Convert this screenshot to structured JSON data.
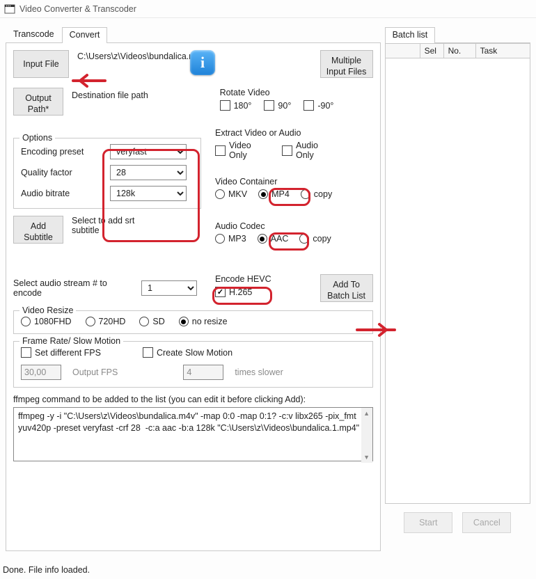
{
  "window": {
    "title": "Video Converter & Transcoder"
  },
  "tabs": {
    "left": [
      {
        "label": "Transcode",
        "active": false
      },
      {
        "label": "Convert",
        "active": true
      }
    ],
    "right": [
      {
        "label": "Batch list",
        "active": true
      }
    ]
  },
  "inputFile": {
    "button": "Input File",
    "path": "C:\\Users\\z\\Videos\\bundalica.m4v"
  },
  "multiInput": {
    "button": "Multiple Input Files"
  },
  "outputPath": {
    "button": "Output Path*",
    "label": "Destination file path"
  },
  "rotate": {
    "title": "Rotate Video",
    "o180": "180°",
    "o90": "90°",
    "on90": "-90°"
  },
  "extract": {
    "title": "Extract Video or Audio",
    "video": "Video Only",
    "audio": "Audio Only"
  },
  "options": {
    "title": "Options",
    "preset_label": "Encoding preset",
    "preset": "veryfast",
    "quality_label": "Quality factor",
    "quality": "28",
    "abitrate_label": "Audio bitrate",
    "abitrate": "128k"
  },
  "container": {
    "title": "Video Container",
    "mkv": "MKV",
    "mp4": "MP4",
    "copy": "copy",
    "selected": "mp4"
  },
  "acodec": {
    "title": "Audio Codec",
    "mp3": "MP3",
    "aac": "AAC",
    "copy": "copy",
    "selected": "aac"
  },
  "subtitle": {
    "button": "Add Subtitle",
    "hint": "Select to add srt subtitle"
  },
  "hevc": {
    "title": "Encode HEVC",
    "label": "H.265",
    "checked": true
  },
  "audioStream": {
    "label": "Select audio stream # to encode",
    "value": "1"
  },
  "addBatch": {
    "button": "Add To Batch List"
  },
  "resize": {
    "title": "Video Resize",
    "o1080": "1080FHD",
    "o720": "720HD",
    "sd": "SD",
    "none": "no resize",
    "selected": "none"
  },
  "fps": {
    "title": "Frame Rate/ Slow Motion",
    "setfps_label": "Set different FPS",
    "outfps_label": "Output FPS",
    "outfps": "30,00",
    "slow_label": "Create Slow Motion",
    "times_label": "times slower",
    "times": "4"
  },
  "cmd": {
    "caption": "ffmpeg command to be added to the list (you can edit it before clicking Add):",
    "text": "ffmpeg -y -i \"C:\\Users\\z\\Videos\\bundalica.m4v\" -map 0:0 -map 0:1? -c:v libx265 -pix_fmt yuv420p -preset veryfast -crf 28  -c:a aac -b:a 128k \"C:\\Users\\z\\Videos\\bundalica.1.mp4\""
  },
  "batch": {
    "cols": {
      "blank": "",
      "sel": "Sel",
      "no": "No.",
      "task": "Task"
    },
    "start": "Start",
    "cancel": "Cancel"
  },
  "status": "Done. File info loaded."
}
